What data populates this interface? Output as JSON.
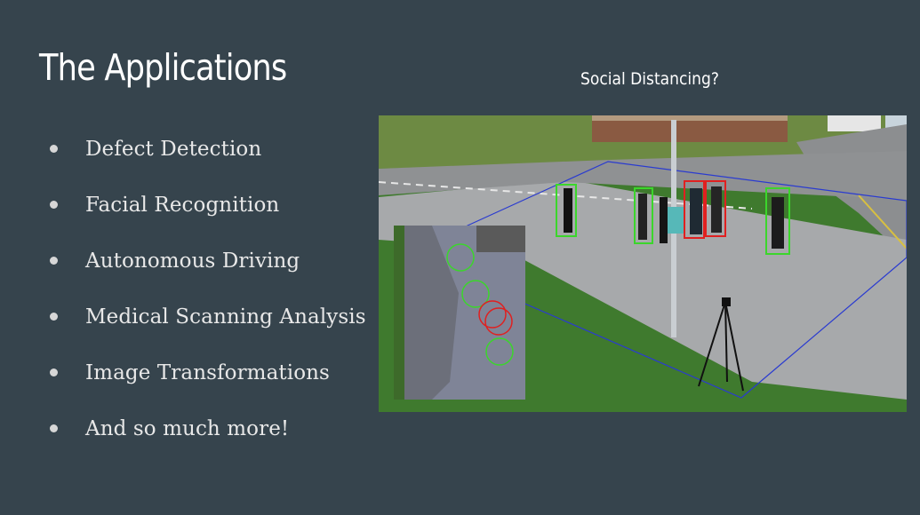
{
  "slide": {
    "title": "The Applications",
    "bullets": [
      "Defect Detection",
      "Facial Recognition",
      "Autonomous Driving",
      "Medical Scanning Analysis",
      "Image Transformations",
      "And so much more!"
    ],
    "image_caption": "Social Distancing?"
  },
  "colors": {
    "background": "#36444d",
    "safe_box": "#3bd62b",
    "violation_box": "#e02020",
    "ground_plane": "#2a3bd0"
  }
}
